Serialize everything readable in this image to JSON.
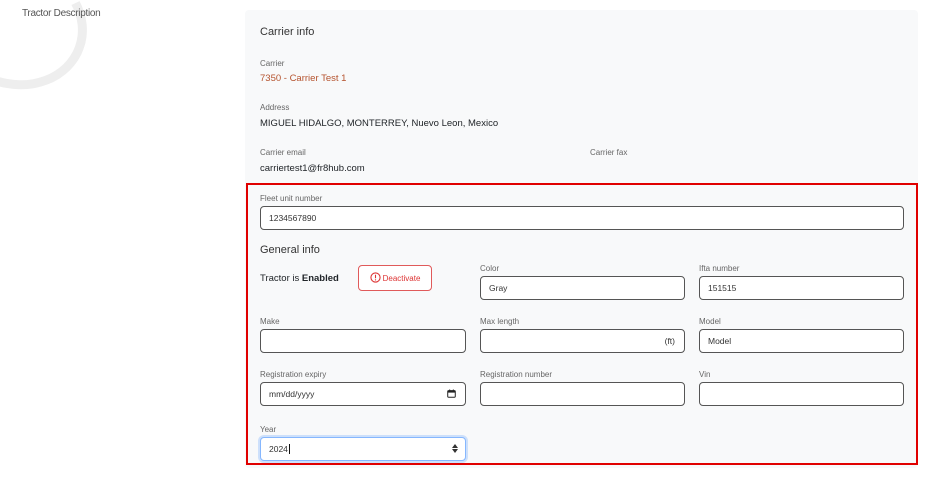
{
  "sidebar": {
    "title": "Tractor Description"
  },
  "carrier_info": {
    "heading": "Carrier info",
    "carrier_label": "Carrier",
    "carrier_value": "7350 - Carrier Test 1",
    "address_label": "Address",
    "address_value": "MIGUEL HIDALGO, MONTERREY, Nuevo Leon, Mexico",
    "email_label": "Carrier email",
    "email_value": "carriertest1@fr8hub.com",
    "fax_label": "Carrier fax",
    "fax_value": ""
  },
  "fleet": {
    "label": "Fleet unit number",
    "value": "1234567890"
  },
  "general": {
    "heading": "General info",
    "status_prefix": "Tractor is",
    "status_value": "Enabled",
    "deactivate_label": "Deactivate",
    "color_label": "Color",
    "color_value": "Gray",
    "ifta_label": "Ifta number",
    "ifta_value": "151515",
    "make_label": "Make",
    "make_value": "",
    "max_length_label": "Max length",
    "max_length_value": "",
    "max_length_unit": "(ft)",
    "model_label": "Model",
    "model_value": "Model",
    "reg_expiry_label": "Registration expiry",
    "reg_expiry_value": "mm/dd/yyyy",
    "reg_number_label": "Registration number",
    "reg_number_value": "",
    "vin_label": "Vin",
    "vin_value": "",
    "year_label": "Year",
    "year_value": "2024"
  },
  "colors": {
    "highlight": "#e00000",
    "link": "#b5532e",
    "deactivate": "#d33333",
    "card_bg": "#f8f9fa"
  }
}
